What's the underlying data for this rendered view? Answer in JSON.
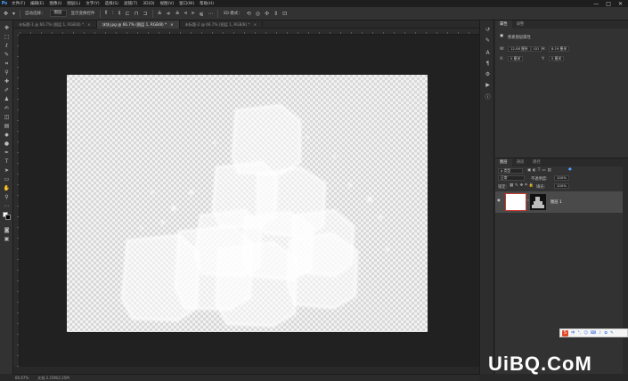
{
  "menubar": {
    "logo": "Ps",
    "items": [
      "文件(F)",
      "编辑(E)",
      "图像(I)",
      "图层(L)",
      "文字(Y)",
      "选择(S)",
      "滤镜(T)",
      "3D(D)",
      "视图(V)",
      "窗口(W)",
      "帮助(H)"
    ],
    "window_controls": [
      "—",
      "□",
      "✕"
    ]
  },
  "options": {
    "auto_select_label": "自动选择：",
    "target_value": "图层",
    "transform_label": "显示变换控件",
    "mode_3d_label": "3D 模式："
  },
  "tabs": [
    {
      "label": "未标题-1 @ 66.7% (图层 1, RGB/8) *"
    },
    {
      "label": "冰块.jpg @ 66.7% (图层 1, RGB/8) *"
    },
    {
      "label": "未标题-2 @ 66.7% (图层 1, RGB/8) *"
    }
  ],
  "statusbar": {
    "zoom": "66.67%",
    "doc_info": "文档:2.25M/2.25M"
  },
  "properties": {
    "tabs": [
      "属性",
      "调整"
    ],
    "title": "像素图层属性",
    "w_label": "W:",
    "w_value": "12.08 厘米",
    "h_label": "H:",
    "h_value": "8.19 厘米",
    "link_label": "GO",
    "x_label": "X:",
    "x_value": "0 厘米",
    "y_label": "Y:",
    "y_value": "0 厘米"
  },
  "layers": {
    "tabs": [
      "图层",
      "通道",
      "路径"
    ],
    "kind_label": "ρ 类型",
    "blend_mode": "正常",
    "opacity_label": "不透明度:",
    "opacity_value": "100%",
    "lock_label": "锁定:",
    "fill_label": "填充:",
    "fill_value": "100%",
    "layer_name": "图层 1"
  },
  "ime": {
    "logo": "S",
    "items": [
      "中",
      "°,",
      "☺",
      "⌨",
      "♪",
      "✿",
      "✎"
    ]
  },
  "watermark": "UiBQ.CoM",
  "colors": {
    "accent": "#4aa3ff",
    "selection_outline": "#d0392b"
  }
}
